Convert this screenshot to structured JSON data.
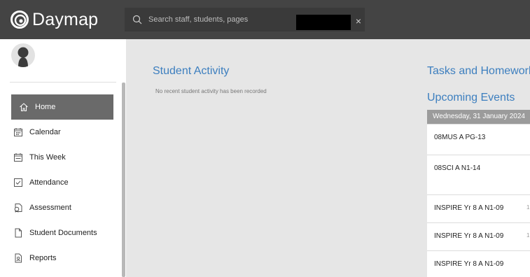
{
  "app": {
    "name": "Daymap"
  },
  "search": {
    "placeholder": "Search staff, students, pages",
    "clear_symbol": "×"
  },
  "sidebar": {
    "items": [
      {
        "label": "Home",
        "icon": "home-icon",
        "active": true
      },
      {
        "label": "Calendar",
        "icon": "calendar-icon"
      },
      {
        "label": "This Week",
        "icon": "this-week-icon"
      },
      {
        "label": "Attendance",
        "icon": "checkbox-icon"
      },
      {
        "label": "Assessment",
        "icon": "assessment-icon"
      },
      {
        "label": "Student Documents",
        "icon": "document-icon"
      },
      {
        "label": "Reports",
        "icon": "report-icon"
      }
    ]
  },
  "main": {
    "student_activity": {
      "title": "Student Activity",
      "empty_message": "No recent student activity has been recorded"
    },
    "tasks": {
      "title": "Tasks and Homework"
    },
    "events": {
      "title": "Upcoming Events",
      "date": "Wednesday, 31 January 2024",
      "items": [
        {
          "name": "08MUS A PG-13",
          "extra": ""
        },
        {
          "name": "08SCI A N1-14",
          "extra": ""
        },
        {
          "name": "INSPIRE Yr 8 A N1-09",
          "extra": "1"
        },
        {
          "name": "INSPIRE Yr 8 A N1-09",
          "extra": "1"
        },
        {
          "name": "INSPIRE Yr 8 A N1-09",
          "extra": ""
        }
      ]
    }
  },
  "colors": {
    "topbar": "#444444",
    "accent_blue": "#3d7fbf",
    "active_nav": "#6a6a6a",
    "content_bg": "#e6e6e6",
    "date_header": "#9b9b9b"
  }
}
